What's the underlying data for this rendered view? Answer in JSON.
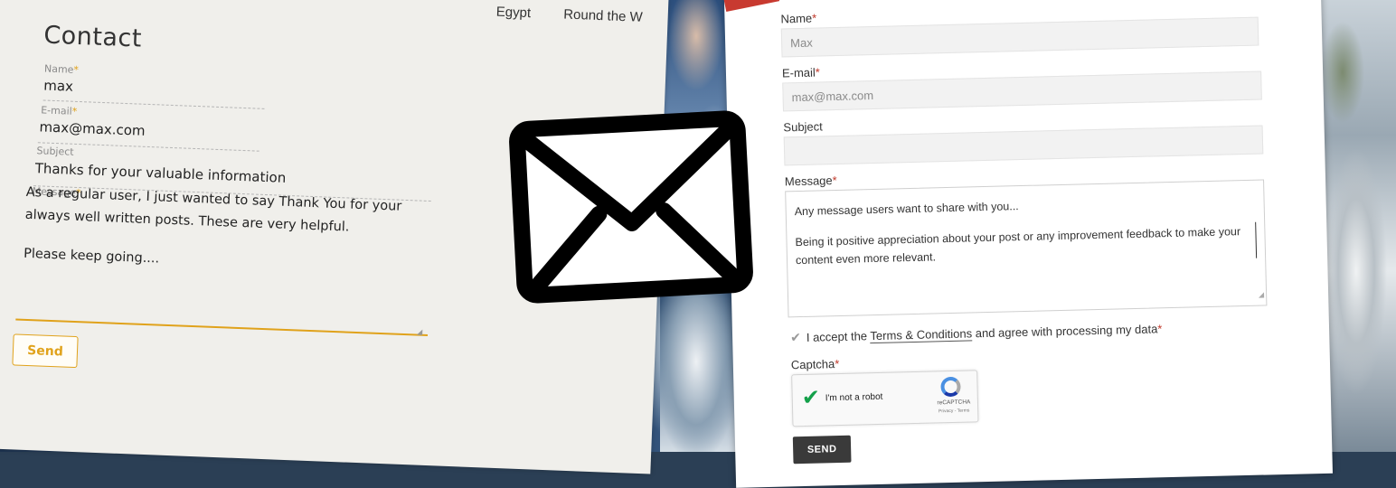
{
  "left_form": {
    "nav_items": [
      "Egypt",
      "Round the W"
    ],
    "title": "Contact",
    "name_label": "Name",
    "name_value": "max",
    "email_label": "E-mail",
    "email_value": "max@max.com",
    "subject_label": "Subject",
    "subject_value": "Thanks for your valuable information",
    "message_label": "Message",
    "message_line1": "As a regular user, I just wanted to say Thank You for your always well written posts. These are very helpful.",
    "message_line2": "Please keep going....",
    "required_mark": "*",
    "send_label": "Send",
    "accent_color": "#e0a21b"
  },
  "icons": {
    "envelope": "mail-envelope-icon",
    "checkbox_tick": "checkmark-icon",
    "captcha_tick": "checkmark-icon",
    "recaptcha": "recaptcha-logo-icon",
    "resize": "resize-handle-icon"
  },
  "right_form": {
    "name_label": "Name",
    "name_placeholder": "Max",
    "email_label": "E-mail",
    "email_placeholder": "max@max.com",
    "subject_label": "Subject",
    "subject_value": "",
    "message_label": "Message",
    "message_para1": "Any message users want to share with you...",
    "message_para2": "Being it positive appreciation about your post or any improvement feedback to make your content even more relevant.",
    "required_mark": "*",
    "terms_prefix": "I accept the",
    "terms_link": "Terms & Conditions",
    "terms_suffix": "and agree with processing my data",
    "captcha_label": "Captcha",
    "captcha_text": "I'm not a robot",
    "captcha_brand": "reCAPTCHA",
    "captcha_terms": "Privacy - Terms",
    "send_label": "SEND",
    "required_color": "#c0392b"
  }
}
